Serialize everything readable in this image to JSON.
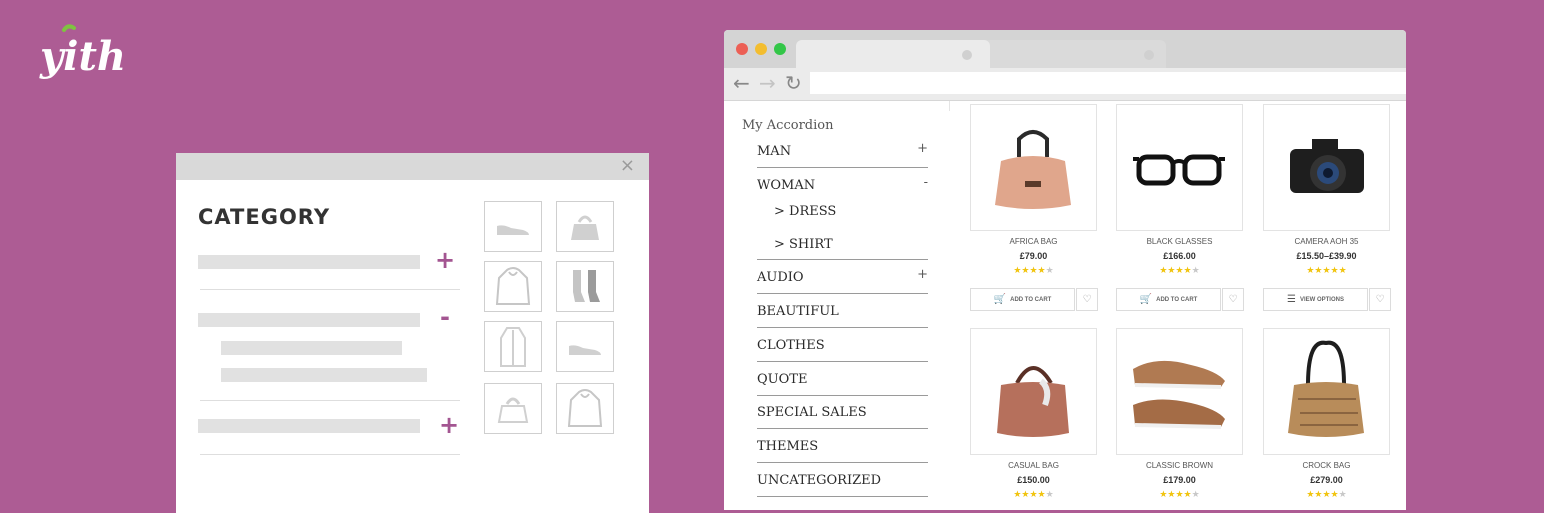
{
  "brand": {
    "logo_text": "yith"
  },
  "widget": {
    "title": "CATEGORY",
    "close_symbol": "×",
    "signs": [
      "+",
      "-",
      "+"
    ],
    "thumbnails": [
      "shoe-icon",
      "bag-icon",
      "hoodie-icon",
      "socks-icon",
      "coat-icon",
      "shoe-icon",
      "bag-icon",
      "hoodie-icon"
    ]
  },
  "browser": {
    "traffic_lights": [
      "#ec5f55",
      "#f3bd2f",
      "#33c648"
    ],
    "nav": {
      "back": "←",
      "forward": "→",
      "reload": "↻"
    }
  },
  "accordion": {
    "title": "My Accordion",
    "items": [
      {
        "label": "MAN",
        "toggle": "+"
      },
      {
        "label": "WOMAN",
        "toggle": "-"
      },
      {
        "label": "AUDIO",
        "toggle": "+"
      },
      {
        "label": "BEAUTIFUL",
        "toggle": ""
      },
      {
        "label": "CLOTHES",
        "toggle": ""
      },
      {
        "label": "QUOTE",
        "toggle": ""
      },
      {
        "label": "SPECIAL SALES",
        "toggle": ""
      },
      {
        "label": "THEMES",
        "toggle": ""
      },
      {
        "label": "UNCATEGORIZED",
        "toggle": ""
      }
    ],
    "subitems": [
      "> DRESS",
      "> SHIRT"
    ]
  },
  "products": [
    {
      "name": "AFRICA BAG",
      "price": "£79.00",
      "rating": 4,
      "cta": "ADD TO CART",
      "cta_icon": "cart-icon",
      "image": "handbag-icon"
    },
    {
      "name": "BLACK GLASSES",
      "price": "£166.00",
      "rating": 4,
      "cta": "ADD TO CART",
      "cta_icon": "cart-icon",
      "image": "glasses-icon"
    },
    {
      "name": "CAMERA AOH 35",
      "price": "£15.50–£39.90",
      "rating": 5,
      "cta": "VIEW OPTIONS",
      "cta_icon": "list-icon",
      "image": "camera-icon"
    },
    {
      "name": "CASUAL BAG",
      "price": "£150.00",
      "rating": 4,
      "image": "handbag-icon"
    },
    {
      "name": "CLASSIC BROWN",
      "price": "£179.00",
      "rating": 4,
      "image": "sneakers-icon"
    },
    {
      "name": "CROCK BAG",
      "price": "£279.00",
      "rating": 4,
      "image": "handbag-icon"
    }
  ],
  "colors": {
    "background": "#ad5c94",
    "accent": "#a35591",
    "star": "#f1c40f"
  }
}
